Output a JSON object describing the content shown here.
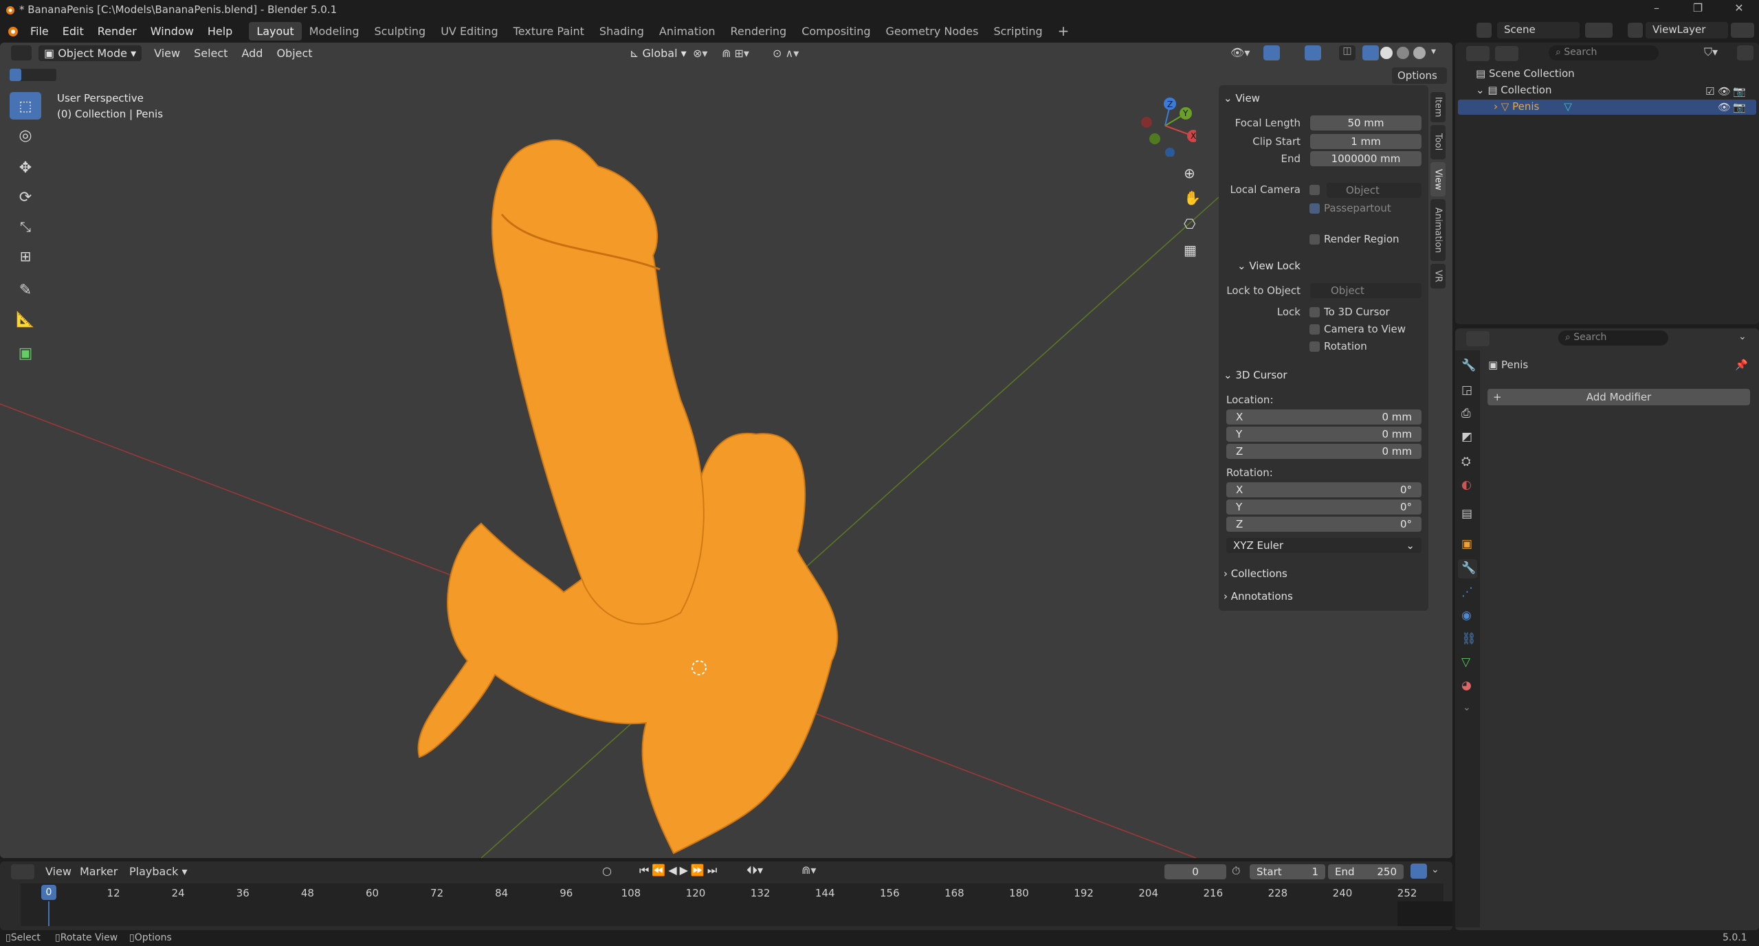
{
  "titlebar": {
    "title": "* BananaPenis [C:\\Models\\BananaPenis.blend] - Blender 5.0.1"
  },
  "menus": [
    "File",
    "Edit",
    "Render",
    "Window",
    "Help"
  ],
  "workspaces": [
    "Layout",
    "Modeling",
    "Sculpting",
    "UV Editing",
    "Texture Paint",
    "Shading",
    "Animation",
    "Rendering",
    "Compositing",
    "Geometry Nodes",
    "Scripting"
  ],
  "active_workspace": "Layout",
  "scene": {
    "label": "Scene",
    "view_layer": "ViewLayer"
  },
  "viewport_header": {
    "mode": "Object Mode",
    "menus": [
      "View",
      "Select",
      "Add",
      "Object"
    ],
    "transform_orientation": "Global",
    "options_label": "Options"
  },
  "viewport_overlay": {
    "perspective": "User Perspective",
    "collection_info": "(0) Collection | Penis"
  },
  "gizmo": {
    "x": "X",
    "y": "Y",
    "z": "Z"
  },
  "npanel": {
    "tabs": [
      "Item",
      "Tool",
      "View",
      "Animation",
      "VR"
    ],
    "active_tab": "View",
    "view_section": "View",
    "focal_length_label": "Focal Length",
    "focal_length": "50 mm",
    "clip_start_label": "Clip Start",
    "clip_start": "1 mm",
    "clip_end_label": "End",
    "clip_end": "1000000 mm",
    "local_camera_label": "Local Camera",
    "local_camera_placeholder": "Object",
    "passepartout": "Passepartout",
    "render_region": "Render Region",
    "view_lock_section": "View Lock",
    "lock_to_object_label": "Lock to Object",
    "lock_to_object_placeholder": "Object",
    "lock_label": "Lock",
    "lock_3d_cursor": "To 3D Cursor",
    "lock_camera_to_view": "Camera to View",
    "lock_rotation": "Rotation",
    "cursor_section": "3D Cursor",
    "location_label": "Location:",
    "loc_x": "0 mm",
    "loc_y": "0 mm",
    "loc_z": "0 mm",
    "rotation_label": "Rotation:",
    "rot_x": "0°",
    "rot_y": "0°",
    "rot_z": "0°",
    "rotation_mode": "XYZ Euler",
    "axis_x": "X",
    "axis_y": "Y",
    "axis_z": "Z",
    "collections_section": "Collections",
    "annotations_section": "Annotations"
  },
  "outliner": {
    "search_placeholder": "Search",
    "scene_collection": "Scene Collection",
    "collection": "Collection",
    "object": "Penis"
  },
  "properties": {
    "search_placeholder": "Search",
    "object_name": "Penis",
    "add_modifier": "Add Modifier"
  },
  "timeline": {
    "menus": [
      "View",
      "Marker",
      "Playback"
    ],
    "current_frame": "0",
    "start_label": "Start",
    "start": "1",
    "end_label": "End",
    "end": "250",
    "ticks": [
      "0",
      "12",
      "24",
      "36",
      "48",
      "60",
      "72",
      "84",
      "96",
      "108",
      "120",
      "132",
      "144",
      "156",
      "168",
      "180",
      "192",
      "204",
      "216",
      "228",
      "240",
      "252"
    ]
  },
  "statusbar": {
    "select": "Select",
    "rotate_view": "Rotate View",
    "options": "Options",
    "version": "5.0.1"
  },
  "colors": {
    "accent": "#4772b3",
    "object": "#f0a030",
    "x_axis": "#c43b3b",
    "y_axis": "#6a8c2a"
  }
}
